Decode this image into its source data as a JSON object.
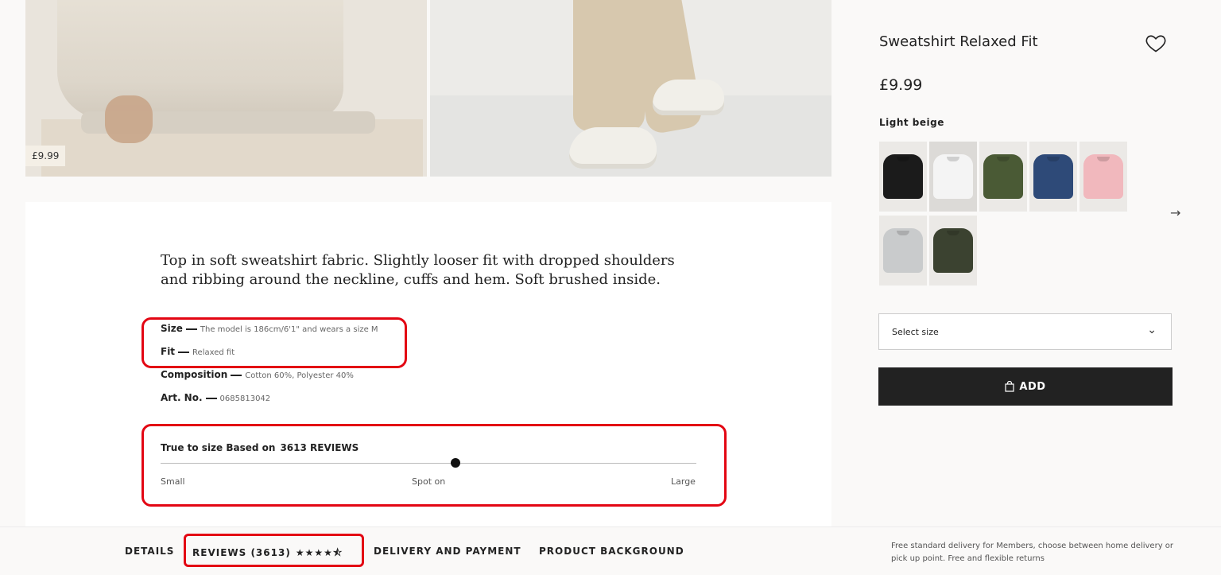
{
  "gallery": {
    "price_badge": "£9.99"
  },
  "product": {
    "description": "Top in soft sweatshirt fabric. Slightly looser fit with dropped shoulders and ribbing around the neckline, cuffs and hem. Soft brushed inside.",
    "specs": [
      {
        "label": "Size",
        "value": "The model is 186cm/6'1\" and wears a size M"
      },
      {
        "label": "Fit",
        "value": "Relaxed fit"
      },
      {
        "label": "Composition",
        "value": "Cotton 60%, Polyester 40%"
      },
      {
        "label": "Art. No.",
        "value": "0685813042"
      }
    ],
    "fit": {
      "title": "True to size Based on",
      "reviews": "3613 REVIEWS",
      "left": "Small",
      "middle": "Spot on",
      "right": "Large",
      "position": 0.55
    }
  },
  "sidebar": {
    "title": "Sweatshirt Relaxed Fit",
    "price": "£9.99",
    "color_name": "Light beige",
    "swatches": [
      "#1b1b1b",
      "#f4f4f4",
      "#4a5a35",
      "#2e4a78",
      "#f1b8bd",
      "#c9cbcc",
      "#3b4230"
    ],
    "select_size_label": "Select size",
    "add_label": "ADD"
  },
  "tabs": {
    "details": "DETAILS",
    "reviews": "REVIEWS (3613)",
    "stars": "★★★★⯪",
    "delivery": "DELIVERY AND PAYMENT",
    "background": "PRODUCT BACKGROUND"
  },
  "footer": {
    "delivery_note": "Free standard delivery for Members, choose between home delivery or pick up point. Free and flexible returns"
  },
  "colors": {
    "highlight": "#e30613",
    "button": "#222222"
  },
  "icons": [
    "heart-icon",
    "arrow-right-icon",
    "chevron-down-icon",
    "bag-icon",
    "star-icon"
  ]
}
